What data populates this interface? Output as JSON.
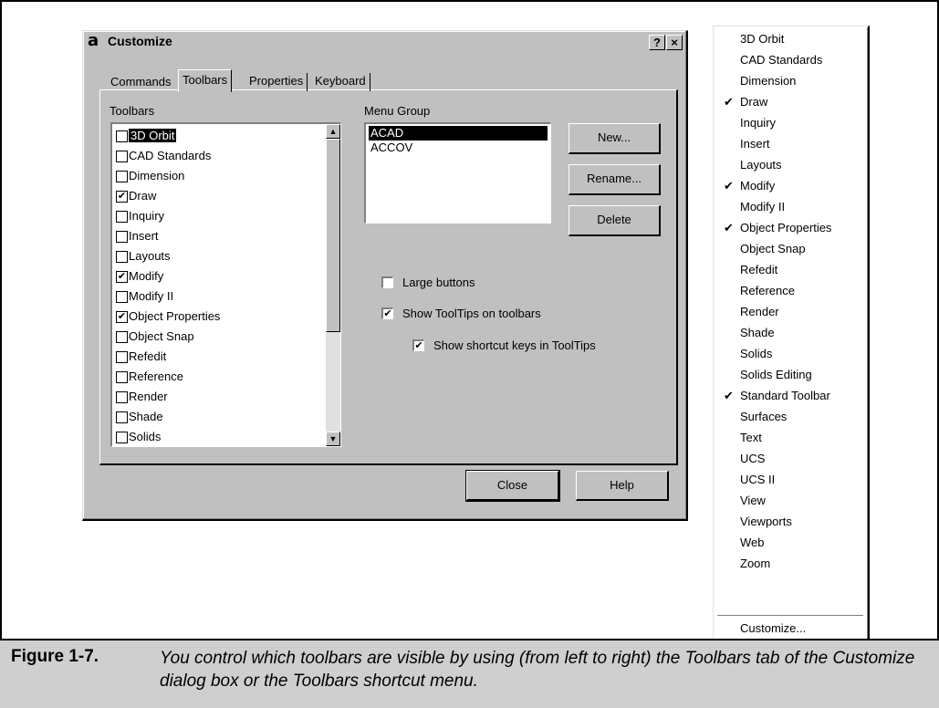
{
  "dialog": {
    "app_icon": "a",
    "title": "Customize",
    "help_glyph": "?",
    "close_glyph": "×",
    "tabs": [
      {
        "label": "Commands"
      },
      {
        "label": "Toolbars"
      },
      {
        "label": "Properties"
      },
      {
        "label": "Keyboard"
      }
    ],
    "toolbars_label": "Toolbars",
    "toolbars": [
      {
        "label": "3D Orbit",
        "checked": false,
        "selected": true
      },
      {
        "label": "CAD Standards",
        "checked": false
      },
      {
        "label": "Dimension",
        "checked": false
      },
      {
        "label": "Draw",
        "checked": true
      },
      {
        "label": "Inquiry",
        "checked": false
      },
      {
        "label": "Insert",
        "checked": false
      },
      {
        "label": "Layouts",
        "checked": false
      },
      {
        "label": "Modify",
        "checked": true
      },
      {
        "label": "Modify II",
        "checked": false
      },
      {
        "label": "Object Properties",
        "checked": true
      },
      {
        "label": "Object Snap",
        "checked": false
      },
      {
        "label": "Refedit",
        "checked": false
      },
      {
        "label": "Reference",
        "checked": false
      },
      {
        "label": "Render",
        "checked": false
      },
      {
        "label": "Shade",
        "checked": false
      },
      {
        "label": "Solids",
        "checked": false
      }
    ],
    "menu_group_label": "Menu Group",
    "menu_groups": [
      {
        "label": "ACAD",
        "selected": true
      },
      {
        "label": "ACCOV"
      }
    ],
    "new_label": "New...",
    "rename_label": "Rename...",
    "delete_label": "Delete",
    "large_buttons_label": "Large buttons",
    "large_buttons_checked": false,
    "show_tooltips_label": "Show ToolTips on toolbars",
    "show_tooltips_checked": true,
    "show_shortcut_label": "Show shortcut keys in ToolTips",
    "show_shortcut_checked": true,
    "close_label": "Close",
    "help_label": "Help"
  },
  "context_menu": {
    "items": [
      {
        "label": "3D Orbit",
        "checked": false
      },
      {
        "label": "CAD Standards",
        "checked": false
      },
      {
        "label": "Dimension",
        "checked": false
      },
      {
        "label": "Draw",
        "checked": true
      },
      {
        "label": "Inquiry",
        "checked": false
      },
      {
        "label": "Insert",
        "checked": false
      },
      {
        "label": "Layouts",
        "checked": false
      },
      {
        "label": "Modify",
        "checked": true
      },
      {
        "label": "Modify II",
        "checked": false
      },
      {
        "label": "Object Properties",
        "checked": true
      },
      {
        "label": "Object Snap",
        "checked": false
      },
      {
        "label": "Refedit",
        "checked": false
      },
      {
        "label": "Reference",
        "checked": false
      },
      {
        "label": "Render",
        "checked": false
      },
      {
        "label": "Shade",
        "checked": false
      },
      {
        "label": "Solids",
        "checked": false
      },
      {
        "label": "Solids Editing",
        "checked": false
      },
      {
        "label": "Standard Toolbar",
        "checked": true
      },
      {
        "label": "Surfaces",
        "checked": false
      },
      {
        "label": "Text",
        "checked": false
      },
      {
        "label": "UCS",
        "checked": false
      },
      {
        "label": "UCS II",
        "checked": false
      },
      {
        "label": "View",
        "checked": false
      },
      {
        "label": "Viewports",
        "checked": false
      },
      {
        "label": "Web",
        "checked": false
      },
      {
        "label": "Zoom",
        "checked": false
      }
    ],
    "customize_label": "Customize..."
  },
  "caption": {
    "label": "Figure 1-7.",
    "text": "You control which toolbars are visible by using (from left to right) the Toolbars tab of the Customize dialog box or the Toolbars shortcut menu."
  }
}
